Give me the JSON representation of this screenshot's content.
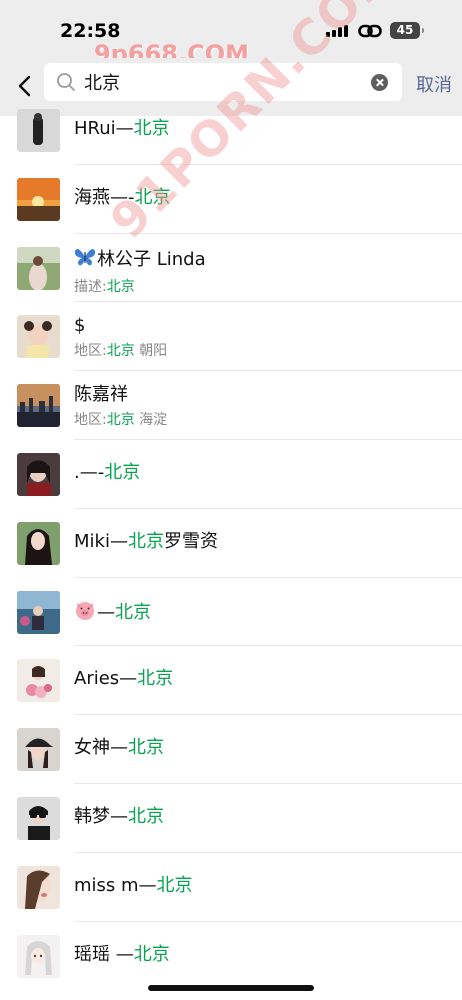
{
  "status_bar": {
    "time": "22:58",
    "battery": "45"
  },
  "watermarks": {
    "top": "9p668.COM",
    "diagonal": "91PORN.COM"
  },
  "search": {
    "query": "北京",
    "cancel_label": "取消"
  },
  "colors": {
    "highlight": "#07a44f",
    "cancel": "#576b95",
    "header_bg": "#ededed"
  },
  "results": [
    {
      "pre": "HRui—",
      "hl": "北京",
      "post": "",
      "avatar": "person-in-corridor"
    },
    {
      "pre": "海燕—-",
      "hl": "北京",
      "post": "",
      "avatar": "sunset"
    },
    {
      "icon": "butterfly-icon",
      "pre": "林公子 Linda",
      "hl": "",
      "post": "",
      "sub_pre": "描述:",
      "sub_hl": "北京",
      "sub_post": "",
      "avatar": "girl-outdoors"
    },
    {
      "pre": "$",
      "hl": "",
      "post": "",
      "sub_pre": "地区:",
      "sub_hl": "北京",
      "sub_post": " 朝阳",
      "avatar": "child-photo"
    },
    {
      "pre": "陈嘉祥",
      "hl": "",
      "post": "",
      "sub_pre": "地区:",
      "sub_hl": "北京",
      "sub_post": " 海淀",
      "avatar": "city-skyline"
    },
    {
      "pre": ".—-",
      "hl": "北京",
      "post": "",
      "avatar": "woman-portrait-dark"
    },
    {
      "pre": "Miki—",
      "hl": "北京",
      "post": "罗雪资",
      "avatar": "woman-long-hair"
    },
    {
      "icon": "pig-icon",
      "pre": "—",
      "hl": "北京",
      "post": "",
      "avatar": "woman-garden"
    },
    {
      "pre": "Aries—",
      "hl": "北京",
      "post": "",
      "avatar": "woman-flowers"
    },
    {
      "pre": "女神—",
      "hl": "北京",
      "post": "",
      "avatar": "woman-cap"
    },
    {
      "pre": "韩梦—",
      "hl": "北京",
      "post": "",
      "avatar": "woman-sunglasses"
    },
    {
      "pre": "miss  m—",
      "hl": "北京",
      "post": "",
      "avatar": "woman-closeup"
    },
    {
      "pre": "瑶瑶 —",
      "hl": "北京",
      "post": "",
      "avatar": "anime-girl"
    }
  ]
}
